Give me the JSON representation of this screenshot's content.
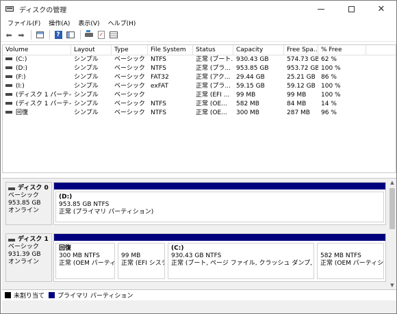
{
  "window": {
    "title": "ディスクの管理",
    "controls": {
      "minimize": "—",
      "maximize": "□",
      "close": "✕"
    }
  },
  "menu": [
    "ファイル(F)",
    "操作(A)",
    "表示(V)",
    "ヘルプ(H)"
  ],
  "toolbar": {
    "icons": [
      "back-arrow-icon",
      "forward-arrow-icon",
      "console-tree-icon",
      "help-icon",
      "properties-icon",
      "disk-connect-icon",
      "check-icon",
      "list-icon"
    ],
    "back": "⬅",
    "forward": "➡",
    "help": "?",
    "check": "✓"
  },
  "volumes": {
    "columns": [
      "Volume",
      "Layout",
      "Type",
      "File System",
      "Status",
      "Capacity",
      "Free Spa...",
      "% Free",
      ""
    ],
    "rows": [
      [
        "(C:)",
        "シンプル",
        "ベーシック",
        "NTFS",
        "正常 (ブート...",
        "930.43 GB",
        "574.73 GB",
        "62 %"
      ],
      [
        "(D:)",
        "シンプル",
        "ベーシック",
        "NTFS",
        "正常 (プラ...",
        "953.85 GB",
        "953.72 GB",
        "100 %"
      ],
      [
        "(F:)",
        "シンプル",
        "ベーシック",
        "FAT32",
        "正常 (アク...",
        "29.44 GB",
        "25.21 GB",
        "86 %"
      ],
      [
        "(I:)",
        "シンプル",
        "ベーシック",
        "exFAT",
        "正常 (プラ...",
        "59.15 GB",
        "59.12 GB",
        "100 %"
      ],
      [
        "(ディスク 1 パーティシ...",
        "シンプル",
        "ベーシック",
        "",
        "正常 (EFI ...",
        "99 MB",
        "99 MB",
        "100 %"
      ],
      [
        "(ディスク 1 パーティシ...",
        "シンプル",
        "ベーシック",
        "NTFS",
        "正常 (OE...",
        "582 MB",
        "84 MB",
        "14 %"
      ],
      [
        "回復",
        "シンプル",
        "ベーシック",
        "NTFS",
        "正常 (OE...",
        "300 MB",
        "287 MB",
        "96 %"
      ]
    ]
  },
  "disks": [
    {
      "name": "ディスク 0",
      "type": "ベーシック",
      "size": "953.85 GB",
      "status": "オンライン",
      "partitions": [
        {
          "label": "(D:)",
          "size": "953.85 GB NTFS",
          "status": "正常 (プライマリ パーティション)"
        }
      ]
    },
    {
      "name": "ディスク 1",
      "type": "ベーシック",
      "size": "931.39 GB",
      "status": "オンライン",
      "partitions": [
        {
          "label": "回復",
          "size": "300 MB NTFS",
          "status": "正常 (OEM パーティシ"
        },
        {
          "label": "",
          "size": "99 MB",
          "status": "正常 (EFI システ"
        },
        {
          "label": "(C:)",
          "size": "930.43 GB NTFS",
          "status": "正常 (ブート, ページ ファイル, クラッシュ ダンプ, プライマリ パ"
        },
        {
          "label": "",
          "size": "582 MB NTFS",
          "status": "正常 (OEM パーティシ"
        }
      ]
    }
  ],
  "legend": {
    "unallocated": "未割り当て",
    "primary": "プライマリ パーティション"
  },
  "colors": {
    "partition_bar": "#00007f",
    "unallocated": "#000000"
  }
}
